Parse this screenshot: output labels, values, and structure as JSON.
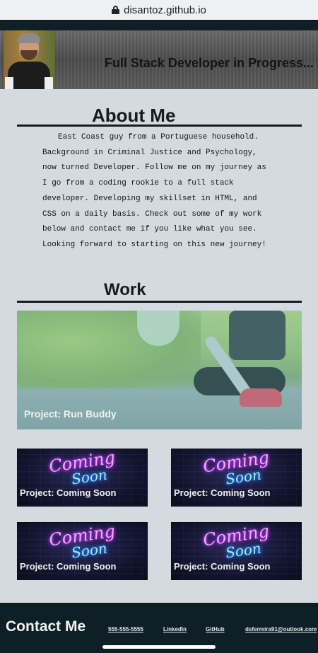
{
  "browser": {
    "url": "disantoz.github.io"
  },
  "header": {
    "title": "Full Stack Developer in Progress..."
  },
  "about": {
    "title": "About Me",
    "text": "East Coast guy from a Portuguese household. Background in Criminal Justice and Psychology, now turned Developer. Follow me on my journey as I go from a coding rookie to a full stack developer. Developing my skillset in HTML, and CSS on a daily basis. Check out some of my work below and contact me if you like what you see. Looking forward to starting on this new journey!"
  },
  "work": {
    "title": "Work",
    "featured": {
      "label": "Project: Run Buddy"
    },
    "cards": [
      {
        "label": "Project: Coming Soon",
        "neon_line1": "Coming",
        "neon_line2": "Soon"
      },
      {
        "label": "Project: Coming Soon",
        "neon_line1": "Coming",
        "neon_line2": "Soon"
      },
      {
        "label": "Project: Coming Soon",
        "neon_line1": "Coming",
        "neon_line2": "Soon"
      },
      {
        "label": "Project: Coming Soon",
        "neon_line1": "Coming",
        "neon_line2": "Soon"
      }
    ]
  },
  "contact": {
    "title": "Contact Me",
    "links": [
      {
        "label": "555-555-5555"
      },
      {
        "label": "LinkedIn"
      },
      {
        "label": "GitHub"
      },
      {
        "label": "dsferreira91@outlook.com"
      }
    ]
  },
  "icons": {
    "lock": "lock-icon"
  },
  "colors": {
    "dark_bar": "#0f1f26",
    "page_bg": "#d5dae0",
    "text_dark": "#161b22"
  }
}
